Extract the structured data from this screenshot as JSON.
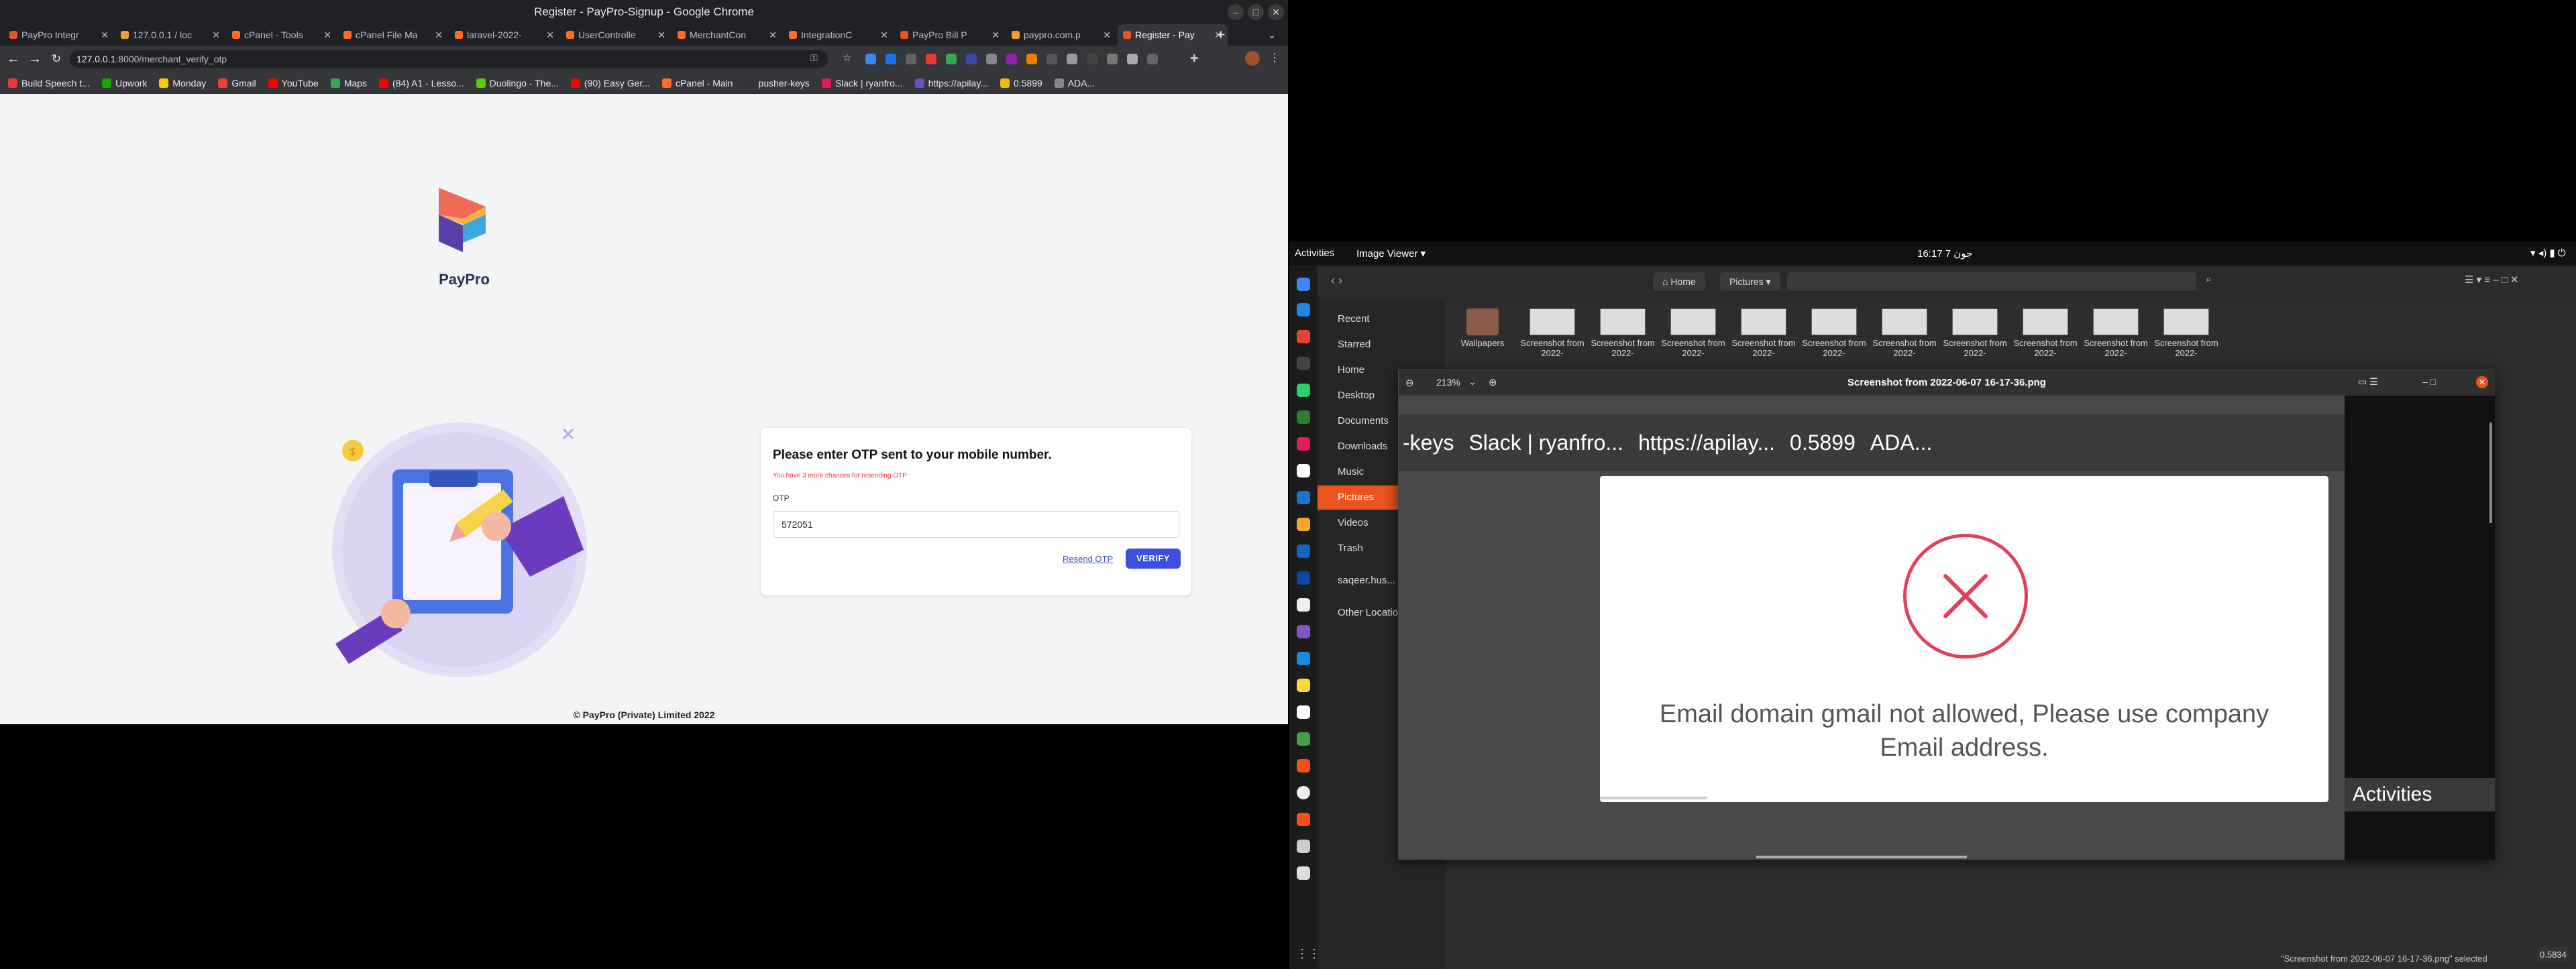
{
  "chrome": {
    "window_title": "Register - PayPro-Signup - Google Chrome",
    "tabs": [
      {
        "label": "PayPro Integr",
        "favicon_color": "#e95420"
      },
      {
        "label": "127.0.0.1 / loc",
        "favicon_color": "#f0a030"
      },
      {
        "label": "cPanel - Tools",
        "favicon_color": "#ff6c2c"
      },
      {
        "label": "cPanel File Ma",
        "favicon_color": "#ff6c2c"
      },
      {
        "label": "laravel-2022-",
        "favicon_color": "#ff6c2c"
      },
      {
        "label": "UserControlle",
        "favicon_color": "#ff6c2c"
      },
      {
        "label": "MerchantCon",
        "favicon_color": "#ff6c2c"
      },
      {
        "label": "IntegrationC",
        "favicon_color": "#ff6c2c"
      },
      {
        "label": "PayPro Bill P",
        "favicon_color": "#e95420"
      },
      {
        "label": "paypro.com.p",
        "favicon_color": "#f0a030"
      },
      {
        "label": "Register - Pay",
        "favicon_color": "#e95420"
      }
    ],
    "active_tab_index": 10,
    "url_host": "127.0.0.1",
    "url_rest": ":8000/merchant_verify_otp",
    "bookmarks": [
      {
        "label": "Build Speech t...",
        "color": "#e53935"
      },
      {
        "label": "Upwork",
        "color": "#14a800"
      },
      {
        "label": "Monday",
        "color": "#ffcc00"
      },
      {
        "label": "Gmail",
        "color": "#ea4335"
      },
      {
        "label": "YouTube",
        "color": "#ff0000"
      },
      {
        "label": "Maps",
        "color": "#34a853"
      },
      {
        "label": "(84) A1 - Lesso...",
        "color": "#ff0000"
      },
      {
        "label": "Duolingo - The...",
        "color": "#58cc02"
      },
      {
        "label": "(90) Easy Ger...",
        "color": "#ff0000"
      },
      {
        "label": "cPanel - Main",
        "color": "#ff6c2c"
      },
      {
        "label": "pusher-keys",
        "color": "#333333"
      },
      {
        "label": "Slack | ryanfro...",
        "color": "#e01e5a"
      },
      {
        "label": "https://apilay...",
        "color": "#6b4fbb"
      },
      {
        "label": "0.5899",
        "color": "#f0b90b"
      },
      {
        "label": "ADA...",
        "color": "#888888"
      }
    ]
  },
  "page": {
    "brand": "PayPro",
    "card_title": "Please enter OTP sent to your mobile number.",
    "card_note": "You have 3 more chances for resending OTP",
    "otp_label": "OTP",
    "otp_value": "572051",
    "resend_label": "Resend OTP",
    "verify_label": "VERIFY",
    "footer": "© PayPro (Private) Limited 2022"
  },
  "gnome": {
    "activities": "Activities",
    "app_menu": "Image Viewer",
    "clock": "16:17  7 جون",
    "breadcrumb_home": "Home",
    "breadcrumb_pictures": "Pictures",
    "sidebar": [
      "Recent",
      "Starred",
      "Home",
      "Desktop",
      "Documents",
      "Downloads",
      "Music",
      "Pictures",
      "Videos",
      "Trash",
      "saqeer.hus...",
      "Other Locations"
    ],
    "selected_sidebar_index": 7,
    "folder": "Wallpapers",
    "thumbs": [
      "Screenshot from 2022-",
      "Screenshot from 2022-",
      "Screenshot from 2022-",
      "Screenshot from 2022-",
      "Screenshot from 2022-",
      "Screenshot from 2022-",
      "Screenshot from 2022-",
      "Screenshot from 2022-",
      "Screenshot from 2022-",
      "Screenshot from 2022-"
    ],
    "status_bar": "\"Screenshot from 2022-06-07 16-17-36.png\" selected",
    "corner_value": "0.5834"
  },
  "viewer": {
    "title": "Screenshot from 2022-06-07 16-17-36.png",
    "zoom": "213%",
    "strip": [
      "-keys",
      "Slack | ryanfro...",
      "https://apilay...",
      "0.5899",
      "ADA..."
    ],
    "error_message": "Email domain gmail not allowed, Please use company Email address.",
    "activities": "Activities"
  }
}
